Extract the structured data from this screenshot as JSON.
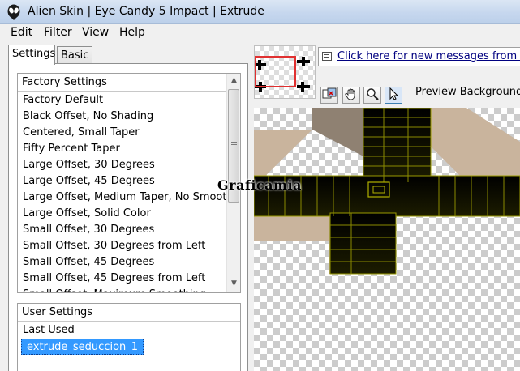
{
  "window": {
    "title": "Alien Skin | Eye Candy 5 Impact | Extrude",
    "icon": "alien-head-icon"
  },
  "menu": [
    "Edit",
    "Filter",
    "View",
    "Help"
  ],
  "tabs": {
    "settings": "Settings",
    "basic": "Basic",
    "active": "Settings"
  },
  "factory_settings": {
    "header": "Factory Settings",
    "items": [
      "Factory Default",
      "Black Offset, No Shading",
      "Centered, Small Taper",
      "Fifty Percent Taper",
      "Large Offset, 30 Degrees",
      "Large Offset, 45 Degrees",
      "Large Offset, Medium Taper, No Smooth…",
      "Large Offset, Solid Color",
      "Small Offset, 30 Degrees",
      "Small Offset, 30 Degrees from Left",
      "Small Offset, 45 Degrees",
      "Small Offset, 45 Degrees from Left",
      "Small Offset, Maximum Smoothing"
    ]
  },
  "user_settings": {
    "header": "User Settings",
    "items": [
      "Last Used",
      "extrude_seduccion_1"
    ],
    "selected": "extrude_seduccion_1"
  },
  "messages": {
    "link": "Click here for new messages from Alie",
    "icon": "message-icon"
  },
  "toolbar": {
    "tools": [
      "compare-icon",
      "hand-icon",
      "zoom-icon",
      "pointer-icon"
    ],
    "preview_bg_label": "Preview Background:"
  },
  "preview": {
    "watermark": "Graficamia"
  },
  "colors": {
    "extrude_face": "#000000",
    "extrude_edge": "#c8c800",
    "bevel_tan": "#c9b49d",
    "bevel_dark": "#8c7f72",
    "selection": "#3399ff"
  }
}
